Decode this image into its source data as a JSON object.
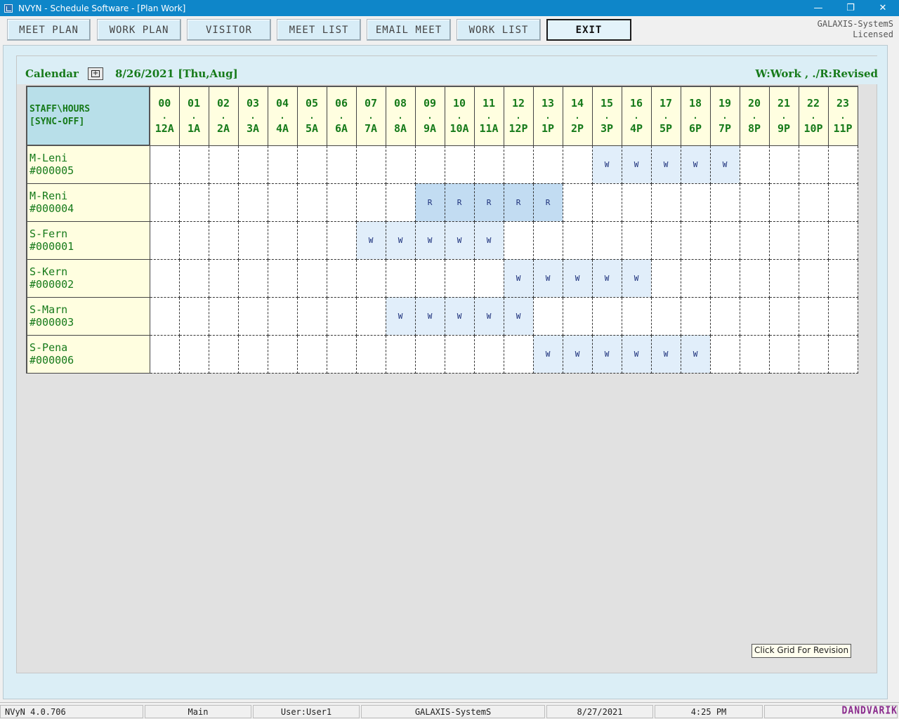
{
  "window": {
    "title": "NVYN - Schedule Software - [Plan Work]"
  },
  "toolbar": {
    "buttons": [
      {
        "label": "MEET PLAN"
      },
      {
        "label": "WORK PLAN"
      },
      {
        "label": "VISITOR"
      },
      {
        "label": "MEET LIST"
      },
      {
        "label": "EMAIL MEET"
      },
      {
        "label": "WORK LIST"
      },
      {
        "label": "EXIT"
      }
    ],
    "license_line1": "GALAXIS-SystemS",
    "license_line2": "Licensed"
  },
  "calendar": {
    "label": "Calendar",
    "date": "8/26/2021 [Thu,Aug]",
    "legend": "W:Work , ./R:Revised",
    "header_staff_line1": "STAFF\\HOURS",
    "header_staff_line2": "[SYNC-OFF]",
    "hours": [
      {
        "num": "00",
        "sep": ".",
        "label": "12A"
      },
      {
        "num": "01",
        "sep": ".",
        "label": "1A"
      },
      {
        "num": "02",
        "sep": ".",
        "label": "2A"
      },
      {
        "num": "03",
        "sep": ".",
        "label": "3A"
      },
      {
        "num": "04",
        "sep": ".",
        "label": "4A"
      },
      {
        "num": "05",
        "sep": ".",
        "label": "5A"
      },
      {
        "num": "06",
        "sep": ".",
        "label": "6A"
      },
      {
        "num": "07",
        "sep": ".",
        "label": "7A"
      },
      {
        "num": "08",
        "sep": ".",
        "label": "8A"
      },
      {
        "num": "09",
        "sep": ".",
        "label": "9A"
      },
      {
        "num": "10",
        "sep": ".",
        "label": "10A"
      },
      {
        "num": "11",
        "sep": ".",
        "label": "11A"
      },
      {
        "num": "12",
        "sep": ".",
        "label": "12P"
      },
      {
        "num": "13",
        "sep": ".",
        "label": "1P"
      },
      {
        "num": "14",
        "sep": ".",
        "label": "2P"
      },
      {
        "num": "15",
        "sep": ".",
        "label": "3P"
      },
      {
        "num": "16",
        "sep": ".",
        "label": "4P"
      },
      {
        "num": "17",
        "sep": ".",
        "label": "5P"
      },
      {
        "num": "18",
        "sep": ".",
        "label": "6P"
      },
      {
        "num": "19",
        "sep": ".",
        "label": "7P"
      },
      {
        "num": "20",
        "sep": ".",
        "label": "8P"
      },
      {
        "num": "21",
        "sep": ".",
        "label": "9P"
      },
      {
        "num": "22",
        "sep": ".",
        "label": "10P"
      },
      {
        "num": "23",
        "sep": ".",
        "label": "11P"
      }
    ],
    "staff": [
      {
        "name": "M-Leni",
        "id": "#000005",
        "slots": [
          "",
          "",
          "",
          "",
          "",
          "",
          "",
          "",
          "",
          "",
          "",
          "",
          "",
          "",
          "",
          "W",
          "W",
          "W",
          "W",
          "W",
          "",
          "",
          "",
          ""
        ]
      },
      {
        "name": "M-Reni",
        "id": "#000004",
        "slots": [
          "",
          "",
          "",
          "",
          "",
          "",
          "",
          "",
          "",
          "R",
          "R",
          "R",
          "R",
          "R",
          "",
          "",
          "",
          "",
          "",
          "",
          "",
          "",
          "",
          ""
        ]
      },
      {
        "name": "S-Fern",
        "id": "#000001",
        "slots": [
          "",
          "",
          "",
          "",
          "",
          "",
          "",
          "W",
          "W",
          "W",
          "W",
          "W",
          "",
          "",
          "",
          "",
          "",
          "",
          "",
          "",
          "",
          "",
          "",
          ""
        ]
      },
      {
        "name": "S-Kern",
        "id": "#000002",
        "slots": [
          "",
          "",
          "",
          "",
          "",
          "",
          "",
          "",
          "",
          "",
          "",
          "",
          "W",
          "W",
          "W",
          "W",
          "W",
          "",
          "",
          "",
          "",
          "",
          "",
          ""
        ]
      },
      {
        "name": "S-Marn",
        "id": "#000003",
        "slots": [
          "",
          "",
          "",
          "",
          "",
          "",
          "",
          "",
          "W",
          "W",
          "W",
          "W",
          "W",
          "",
          "",
          "",
          "",
          "",
          "",
          "",
          "",
          "",
          "",
          ""
        ]
      },
      {
        "name": "S-Pena",
        "id": "#000006",
        "slots": [
          "",
          "",
          "",
          "",
          "",
          "",
          "",
          "",
          "",
          "",
          "",
          "",
          "",
          "W",
          "W",
          "W",
          "W",
          "W",
          "W",
          "",
          "",
          "",
          "",
          ""
        ]
      }
    ],
    "tooltip": "Click Grid For Revision"
  },
  "statusbar": {
    "version": "NVyN 4.0.706",
    "module": "Main",
    "user": "User:User1",
    "company": "GALAXIS-SystemS",
    "date": "8/27/2021",
    "time": "4:25 PM",
    "brand": "DANDVARIK"
  }
}
